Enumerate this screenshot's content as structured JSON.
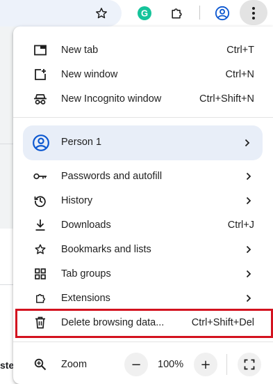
{
  "toolbar": {
    "icons": [
      "bookmark-star-icon",
      "grammarly-extension-icon",
      "extensions-puzzle-icon",
      "profile-icon",
      "chrome-menu-icon"
    ],
    "grammarly_letter": "G"
  },
  "page_fragment": {
    "text": "ste"
  },
  "menu": {
    "group1": [
      {
        "label": "New tab",
        "shortcut": "Ctrl+T",
        "icon": "new-tab-icon"
      },
      {
        "label": "New window",
        "shortcut": "Ctrl+N",
        "icon": "new-window-icon"
      },
      {
        "label": "New Incognito window",
        "shortcut": "Ctrl+Shift+N",
        "icon": "incognito-icon"
      }
    ],
    "profile": {
      "label": "Person 1",
      "icon": "account-circle-icon"
    },
    "group2": [
      {
        "label": "Passwords and autofill",
        "shortcut": "",
        "icon": "key-icon"
      },
      {
        "label": "History",
        "shortcut": "",
        "icon": "history-icon"
      },
      {
        "label": "Downloads",
        "shortcut": "Ctrl+J",
        "icon": "download-icon"
      },
      {
        "label": "Bookmarks and lists",
        "shortcut": "",
        "icon": "star-icon"
      },
      {
        "label": "Tab groups",
        "shortcut": "",
        "icon": "tab-groups-icon"
      },
      {
        "label": "Extensions",
        "shortcut": "",
        "icon": "extensions-icon"
      },
      {
        "label": "Delete browsing data...",
        "shortcut": "Ctrl+Shift+Del",
        "icon": "trash-icon"
      }
    ],
    "zoom": {
      "label": "Zoom",
      "minus": "−",
      "value": "100%",
      "plus": "+",
      "icon": "zoom-icon"
    }
  },
  "colors": {
    "highlight_border": "#d3121f",
    "profile_bg": "#e8eef8",
    "profile_accent": "#0b57d0",
    "grammarly": "#15c39a"
  }
}
